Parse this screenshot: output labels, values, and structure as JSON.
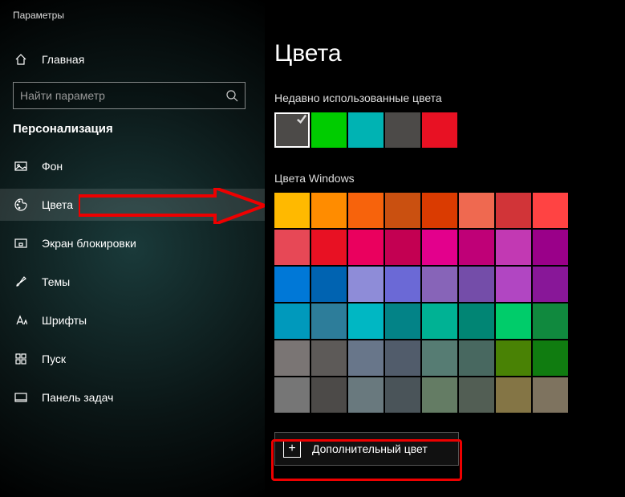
{
  "window_title": "Параметры",
  "home_label": "Главная",
  "search_placeholder": "Найти параметр",
  "section": "Персонализация",
  "nav": [
    {
      "label": "Фон",
      "icon": "picture"
    },
    {
      "label": "Цвета",
      "icon": "palette",
      "selected": true
    },
    {
      "label": "Экран блокировки",
      "icon": "lockscreen"
    },
    {
      "label": "Темы",
      "icon": "brush"
    },
    {
      "label": "Шрифты",
      "icon": "font"
    },
    {
      "label": "Пуск",
      "icon": "start"
    },
    {
      "label": "Панель задач",
      "icon": "taskbar"
    }
  ],
  "page_title": "Цвета",
  "recent_label": "Недавно использованные цвета",
  "recent": [
    {
      "color": "#4c4a48",
      "selected": true
    },
    {
      "color": "#00cc00"
    },
    {
      "color": "#00b3b3"
    },
    {
      "color": "#4c4a48"
    },
    {
      "color": "#e81123"
    }
  ],
  "windows_colors_label": "Цвета Windows",
  "grid": [
    "#ffb900",
    "#ff8c00",
    "#f7630c",
    "#ca5010",
    "#da3b01",
    "#ef6950",
    "#d13438",
    "#ff4343",
    "#e74856",
    "#e81123",
    "#ea005e",
    "#c30052",
    "#e3008c",
    "#bf0077",
    "#c239b3",
    "#9a0089",
    "#0078d7",
    "#0063b1",
    "#8e8cd8",
    "#6b69d6",
    "#8764b8",
    "#744da9",
    "#b146c2",
    "#881798",
    "#0099bc",
    "#2d7d9a",
    "#00b7c3",
    "#038387",
    "#00b294",
    "#018574",
    "#00cc6a",
    "#10893e",
    "#7a7574",
    "#5d5a58",
    "#68768a",
    "#515c6b",
    "#567c73",
    "#486860",
    "#498205",
    "#107c10",
    "#767676",
    "#4c4a48",
    "#69797e",
    "#4a5459",
    "#647c64",
    "#525e54",
    "#847545",
    "#7e735f"
  ],
  "custom_color_label": "Дополнительный цвет"
}
